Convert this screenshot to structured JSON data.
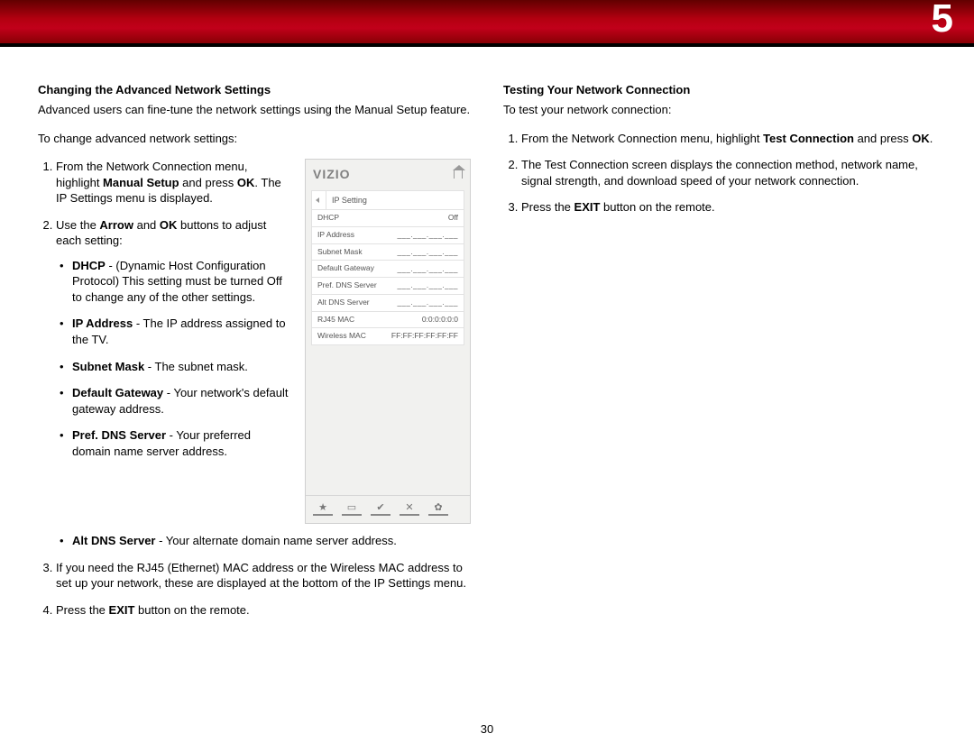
{
  "banner": {
    "chapter": "5"
  },
  "left": {
    "heading": "Changing the Advanced Network Settings",
    "intro": "Advanced users can fine-tune the network settings using the Manual Setup feature.",
    "lead": "To change advanced network settings:",
    "step1_a": "From the Network Connection menu, highlight ",
    "step1_b": "Manual Setup",
    "step1_c": " and press ",
    "step1_d": "OK",
    "step1_e": ". The IP Settings menu is displayed.",
    "step2_a": "Use the ",
    "step2_b": "Arrow",
    "step2_c": " and ",
    "step2_d": "OK",
    "step2_e": " buttons to adjust each setting:",
    "bullets": {
      "dhcp_b": "DHCP",
      "dhcp_t": " - (Dynamic Host Configuration Protocol) This setting must be turned Off to change any of the other settings.",
      "ip_b": "IP Address",
      "ip_t": " - The IP address assigned to the TV.",
      "sub_b": "Subnet Mask",
      "sub_t": " - The subnet mask.",
      "gw_b": "Default Gateway",
      "gw_t": " - Your network's default gateway address.",
      "pdns_b": "Pref. DNS Server",
      "pdns_t": " - Your preferred domain name server address.",
      "adns_b": "Alt DNS Server",
      "adns_t": " - Your alternate domain name server address."
    },
    "step3": "If you need the RJ45 (Ethernet) MAC address or the Wireless MAC address to set up your network, these are displayed at the bottom of the IP Settings menu.",
    "step4_a": "Press the ",
    "step4_b": "EXIT",
    "step4_c": " button on the remote."
  },
  "panel": {
    "logo": "VIZIO",
    "title": "IP Setting",
    "rows": {
      "dhcp_l": "DHCP",
      "dhcp_v": "Off",
      "ip_l": "IP Address",
      "ip_v": "___.___.___.___",
      "sub_l": "Subnet Mask",
      "sub_v": "___.___.___.___",
      "gw_l": "Default Gateway",
      "gw_v": "___.___.___.___",
      "pdns_l": "Pref. DNS Server",
      "pdns_v": "___.___.___.___",
      "adns_l": "Alt DNS Server",
      "adns_v": "___.___.___.___",
      "rj_l": "RJ45 MAC",
      "rj_v": "0:0:0:0:0:0",
      "wm_l": "Wireless MAC",
      "wm_v": "FF:FF:FF:FF:FF:FF"
    },
    "icons": {
      "star": "★",
      "tv": "▭",
      "v": "✔",
      "x": "✕",
      "gear": "✿"
    }
  },
  "right": {
    "heading": "Testing Your Network Connection",
    "intro": "To test your network connection:",
    "step1_a": "From the Network Connection menu, highlight ",
    "step1_b": "Test Connection",
    "step1_c": " and press ",
    "step1_d": "OK",
    "step1_e": ".",
    "step2": "The Test Connection screen displays the connection method, network name, signal strength, and download speed of your network connection.",
    "step3_a": "Press the ",
    "step3_b": "EXIT",
    "step3_c": " button on the remote."
  },
  "footer": {
    "page": "30"
  }
}
